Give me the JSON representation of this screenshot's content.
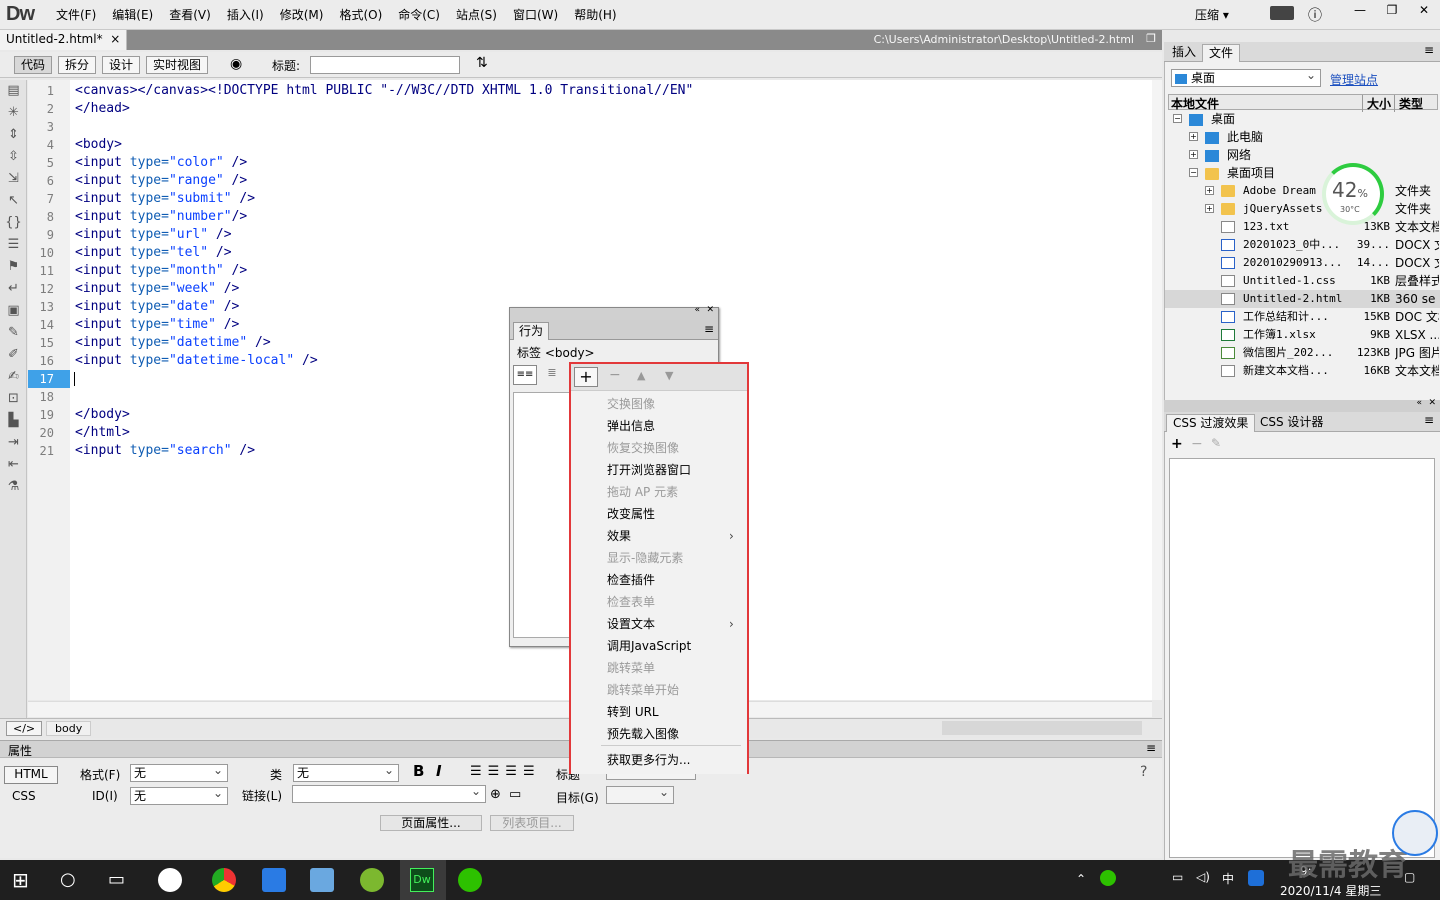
{
  "app": {
    "logo": "Dw",
    "compress_label": "压缩",
    "compress_arrow": "▾"
  },
  "menu": [
    "文件(F)",
    "编辑(E)",
    "查看(V)",
    "插入(I)",
    "修改(M)",
    "格式(O)",
    "命令(C)",
    "站点(S)",
    "窗口(W)",
    "帮助(H)"
  ],
  "document": {
    "tab_name": "Untitled-2.html*",
    "close": "×",
    "path": "C:\\Users\\Administrator\\Desktop\\Untitled-2.html"
  },
  "toolbar": {
    "code": "代码",
    "split": "拆分",
    "design": "设计",
    "live": "实时视图",
    "title_label": "标题:",
    "title_value": ""
  },
  "code": {
    "current_line": 17,
    "lines": [
      "<canvas></canvas><!DOCTYPE html PUBLIC \"-//W3C//DTD XHTML 1.0 Transitional//EN\"",
      "</head>",
      "",
      "<body>",
      "<input type=\"color\" />",
      "<input type=\"range\" />",
      "<input type=\"submit\" />",
      "<input type=\"number\"/>",
      "<input type=\"url\" />",
      "<input type=\"tel\" />",
      "<input type=\"month\" />",
      "<input type=\"week\" />",
      "<input type=\"date\" />",
      "<input type=\"time\" />",
      "<input type=\"datetime\" />",
      "<input type=\"datetime-local\" />",
      "",
      "",
      "</body>",
      "</html>",
      "<input type=\"search\" />"
    ]
  },
  "status": {
    "tag_selector": "body"
  },
  "properties": {
    "header": "属性",
    "html_btn": "HTML",
    "css_btn": "CSS",
    "format_label": "格式(F)",
    "format_value": "无",
    "class_label": "类",
    "class_value": "无",
    "id_label": "ID(I)",
    "id_value": "无",
    "link_label": "链接(L)",
    "link_value": "",
    "title_label": "标题",
    "target_label": "目标(G)",
    "page_props": "页面属性...",
    "list_item": "列表项目..."
  },
  "files_panel": {
    "tab_insert": "插入",
    "tab_files": "文件",
    "location": "桌面",
    "manage": "管理站点",
    "col_local": "本地文件",
    "col_size": "大小",
    "col_type": "类型",
    "tree": [
      {
        "name": "桌面",
        "size": "",
        "type": "",
        "icon": "pc"
      },
      {
        "name": "此电脑",
        "size": "",
        "type": "",
        "icon": "pc"
      },
      {
        "name": "网络",
        "size": "",
        "type": "",
        "icon": "pc"
      },
      {
        "name": "桌面项目",
        "size": "",
        "type": "",
        "icon": "folder"
      },
      {
        "name": "Adobe Dream",
        "size": "",
        "type": "文件夹",
        "icon": "folder"
      },
      {
        "name": "jQueryAssets",
        "size": "",
        "type": "文件夹",
        "icon": "folder"
      },
      {
        "name": "123.txt",
        "size": "13KB",
        "type": "文本文档",
        "icon": "doc"
      },
      {
        "name": "20201023_0中...",
        "size": "39...",
        "type": "DOCX 文",
        "icon": "docx"
      },
      {
        "name": "202010290913...",
        "size": "14...",
        "type": "DOCX 文",
        "icon": "docx"
      },
      {
        "name": "Untitled-1.css",
        "size": "1KB",
        "type": "层叠样式",
        "icon": "doc"
      },
      {
        "name": "Untitled-2.html",
        "size": "1KB",
        "type": "360 se",
        "icon": "doc"
      },
      {
        "name": "工作总结和计...",
        "size": "15KB",
        "type": "DOC 文档",
        "icon": "docx"
      },
      {
        "name": "工作簿1.xlsx",
        "size": "9KB",
        "type": "XLSX ...",
        "icon": "xls"
      },
      {
        "name": "微信图片_202...",
        "size": "123KB",
        "type": "JPG 图片",
        "icon": "img"
      },
      {
        "name": "新建文本文档...",
        "size": "16KB",
        "type": "文本文档",
        "icon": "doc"
      }
    ],
    "selected_index": 10,
    "gauge": {
      "percent": "42",
      "unit": "%",
      "temp": "30°C",
      "fill_fraction": 0.42
    }
  },
  "css_panel": {
    "tab_transitions": "CSS 过渡效果",
    "tab_designer": "CSS 设计器",
    "add": "+",
    "remove": "−"
  },
  "behaviors": {
    "tab": "行为",
    "tag_label": "标签 <body>",
    "menu": [
      {
        "label": "交换图像",
        "enabled": false
      },
      {
        "label": "弹出信息",
        "enabled": true
      },
      {
        "label": "恢复交换图像",
        "enabled": false
      },
      {
        "label": "打开浏览器窗口",
        "enabled": true
      },
      {
        "label": "拖动 AP 元素",
        "enabled": false
      },
      {
        "label": "改变属性",
        "enabled": true
      },
      {
        "label": "效果",
        "enabled": true,
        "submenu": true
      },
      {
        "label": "显示-隐藏元素",
        "enabled": false
      },
      {
        "label": "检查插件",
        "enabled": true
      },
      {
        "label": "检查表单",
        "enabled": false
      },
      {
        "label": "设置文本",
        "enabled": true,
        "submenu": true
      },
      {
        "label": "调用JavaScript",
        "enabled": true
      },
      {
        "label": "跳转菜单",
        "enabled": false
      },
      {
        "label": "跳转菜单开始",
        "enabled": false
      },
      {
        "label": "转到 URL",
        "enabled": true
      },
      {
        "label": "预先载入图像",
        "enabled": true
      },
      {
        "label": "获取更多行为...",
        "enabled": true
      }
    ]
  },
  "taskbar": {
    "clock_time": "9:",
    "clock_date": "2020/11/4 星期三",
    "ime": "中"
  },
  "watermark": "最需教育",
  "colors": {
    "current_line": "#3fa1e8",
    "highlight_border": "#e2383a",
    "tag": "#000080",
    "attr": "#0f5cb3",
    "value": "#0a40ff"
  }
}
